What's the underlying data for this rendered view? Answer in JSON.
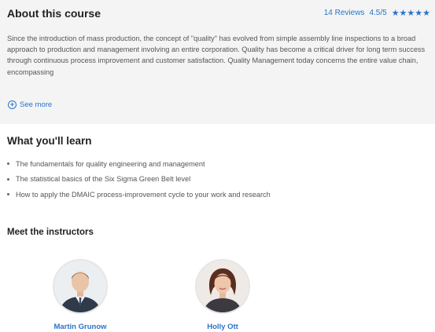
{
  "about": {
    "title": "About this course",
    "reviews": "14 Reviews",
    "rating": "4.5/5",
    "stars": "★★★★★",
    "description": "Since the introduction of mass production, the concept of \"quality\" has evolved from simple assembly line inspections to a broad approach to production and management involving an entire corporation. Quality has become a critical driver for long term success through continuous process improvement and customer satisfaction. Quality Management today concerns the entire value chain, encompassing",
    "see_more": "See more"
  },
  "learn": {
    "title": "What you'll learn",
    "items": [
      "The fundamentals for quality engineering and management",
      "The statistical basics of the Six Sigma Green Belt level",
      "How to apply the DMAIC process-improvement cycle to your work and research"
    ]
  },
  "instructors": {
    "title": "Meet the instructors",
    "people": [
      {
        "name": "Martin Grunow"
      },
      {
        "name": "Holly Ott"
      }
    ]
  },
  "colors": {
    "accent": "#2a73cc",
    "card_bg": "#f4f4f4"
  }
}
